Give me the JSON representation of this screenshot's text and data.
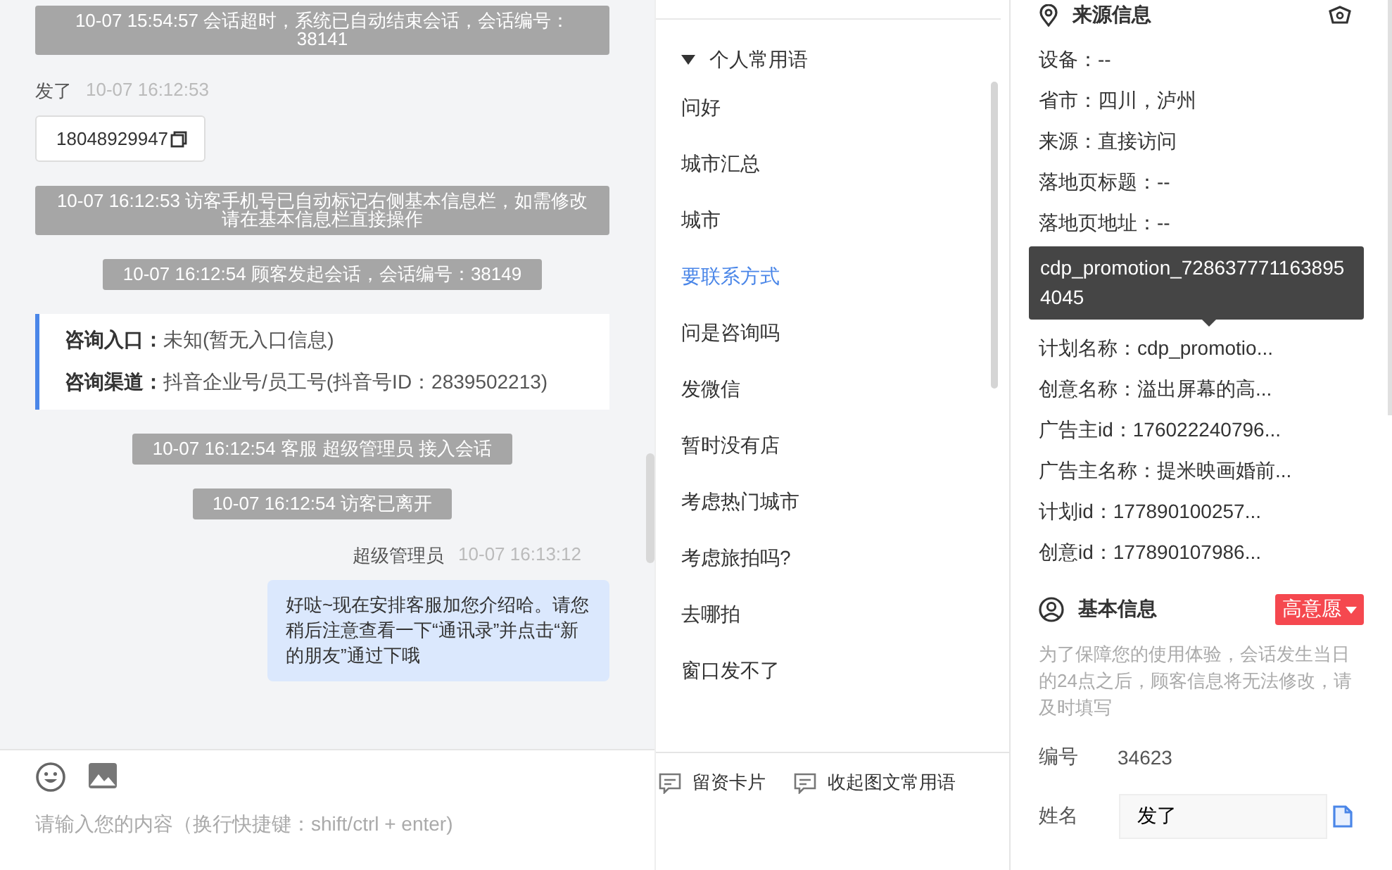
{
  "chat": {
    "messages": [
      {
        "kind": "notice",
        "text": "10-07 15:54:57 会话超时，系统已自动结束会话，会话编号：38141"
      },
      {
        "kind": "visitor",
        "sender": "发了",
        "time": "10-07 16:12:53",
        "text": "18048929947"
      },
      {
        "kind": "notice",
        "text": "10-07 16:12:53 访客手机号已自动标记右侧基本信息栏，如需修改请在基本信息栏直接操作"
      },
      {
        "kind": "notice",
        "text": "10-07 16:12:54 顾客发起会话，会话编号：38149"
      },
      {
        "kind": "entry_card",
        "rows": [
          {
            "label": "咨询入口：",
            "value": "未知(暂无入口信息)"
          },
          {
            "label": "咨询渠道：",
            "value": "抖音企业号/员工号(抖音号ID：2839502213)"
          }
        ]
      },
      {
        "kind": "notice",
        "text": "10-07 16:12:54 客服 超级管理员 接入会话"
      },
      {
        "kind": "notice",
        "text": "10-07 16:12:54 访客已离开"
      },
      {
        "kind": "agent",
        "sender": "超级管理员",
        "time": "10-07 16:13:12",
        "text": "好哒~现在安排客服加您介绍哈。请您稍后注意查看一下“通讯录”并点击“新的朋友”通过下哦"
      }
    ]
  },
  "composer": {
    "placeholder": "请输入您的内容（换行快捷键：shift/ctrl + enter)"
  },
  "phrases": {
    "group": "个人常用语",
    "expanded": true,
    "items": [
      {
        "label": "问好",
        "selected": false
      },
      {
        "label": "城市汇总",
        "selected": false
      },
      {
        "label": "城市",
        "selected": false
      },
      {
        "label": "要联系方式",
        "selected": true
      },
      {
        "label": "问是咨询吗",
        "selected": false
      },
      {
        "label": "发微信",
        "selected": false
      },
      {
        "label": "暂时没有店",
        "selected": false
      },
      {
        "label": "考虑热门城市",
        "selected": false
      },
      {
        "label": "考虑旅拍吗?",
        "selected": false
      },
      {
        "label": "去哪拍",
        "selected": false
      },
      {
        "label": "窗口发不了",
        "selected": false
      }
    ]
  },
  "phrase_actions": [
    "留资卡片",
    "收起图文常用语"
  ],
  "source_info": {
    "title": "来源信息",
    "rows": [
      "设备：--",
      "省市：四川，泸州",
      "来源：直接访问",
      "落地页标题：--",
      "落地页地址：--",
      "计划名称：cdp_promotio...",
      "创意名称：溢出屏幕的高...",
      "广告主id：176022240796...",
      "广告主名称：提米映画婚前...",
      "计划id：177890100257...",
      "创意id：177890107986..."
    ]
  },
  "tooltip": "cdp_promotion_7286377711638954045",
  "basic_info": {
    "title": "基本信息",
    "intent_tag": "高意愿",
    "note": "为了保障您的使用体验，会话发生当日的24点之后，顾客信息将无法修改，请及时填写",
    "fields": [
      {
        "kind": "text",
        "label": "编号",
        "value": "34623"
      },
      {
        "kind": "input",
        "label": "姓名",
        "value": "发了"
      }
    ]
  }
}
